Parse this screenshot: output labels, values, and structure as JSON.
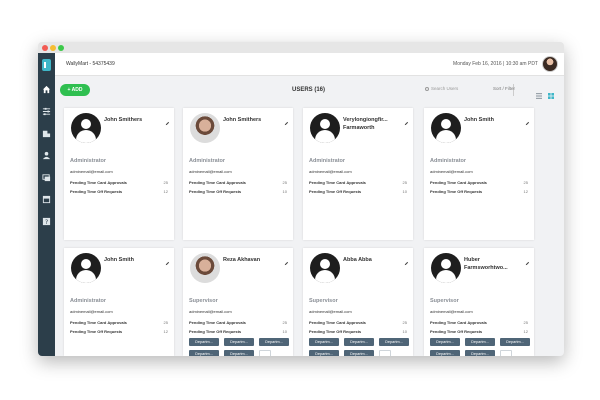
{
  "app": {
    "company": "WallyMart - 54375439",
    "datetime": "Monday Feb 16, 2016 | 10:30 am PDT"
  },
  "sidebar": {
    "icons": [
      "home-icon",
      "sliders-icon",
      "building-icon",
      "person-icon",
      "stack-icon",
      "calendar-icon",
      "help-icon"
    ]
  },
  "toolbar": {
    "add_label": "+ ADD",
    "title": "USERS (16)",
    "search_placeholder": "Search Users",
    "sort_label": "Sort / Filter"
  },
  "users": [
    {
      "name": "John Smithers",
      "role": "Administrator",
      "email": "adminemail@email.com",
      "approvals_label": "Pending Time Card Approvals",
      "approvals": "25",
      "requests_label": "Pending Time Off Requests",
      "requests": "12",
      "tags": []
    },
    {
      "name": "John Smithers",
      "role": "Administrator",
      "email": "adminemail@email.com",
      "approvals_label": "Pending Time Card Approvals",
      "approvals": "25",
      "requests_label": "Pending Time Off Requests",
      "requests": "10",
      "tags": []
    },
    {
      "name": "Verylongiongfir... Farmaworth",
      "role": "Administrator",
      "email": "adminemail@email.com",
      "approvals_label": "Pending Time Card Approvals",
      "approvals": "25",
      "requests_label": "Pending Time Off Requests",
      "requests": "10",
      "tags": []
    },
    {
      "name": "John Smith",
      "role": "Administrator",
      "email": "adminemail@email.com",
      "approvals_label": "Pending Time Card Approvals",
      "approvals": "25",
      "requests_label": "Pending Time Off Requests",
      "requests": "12",
      "tags": []
    },
    {
      "name": "John Smith",
      "role": "Administrator",
      "email": "adminemail@email.com",
      "approvals_label": "Pending Time Card Approvals",
      "approvals": "25",
      "requests_label": "Pending Time Off Requests",
      "requests": "12",
      "tags": []
    },
    {
      "name": "Reza Akhavan",
      "role": "Supervisor",
      "email": "adminemail@email.com",
      "approvals_label": "Pending Time Card Approvals",
      "approvals": "25",
      "requests_label": "Pending Time Off Requests",
      "requests": "10",
      "tags": [
        "Departm...",
        "Departm...",
        "Departm...",
        "Departm...",
        "Departm...",
        ""
      ]
    },
    {
      "name": "Abba Abba",
      "role": "Supervisor",
      "email": "adminemail@email.com",
      "approvals_label": "Pending Time Card Approvals",
      "approvals": "25",
      "requests_label": "Pending Time Off Requests",
      "requests": "10",
      "tags": [
        "Departm...",
        "Departm...",
        "Departm...",
        "Departm...",
        "Departm...",
        ""
      ]
    },
    {
      "name": "Huber Farmsworhtwo...",
      "role": "Supervisor",
      "email": "adminemail@email.com",
      "approvals_label": "Pending Time Card Approvals",
      "approvals": "25",
      "requests_label": "Pending Time Off Requests",
      "requests": "12",
      "tags": [
        "Departm...",
        "Departm...",
        "Departm...",
        "Departm...",
        "Departm...",
        ""
      ]
    }
  ]
}
